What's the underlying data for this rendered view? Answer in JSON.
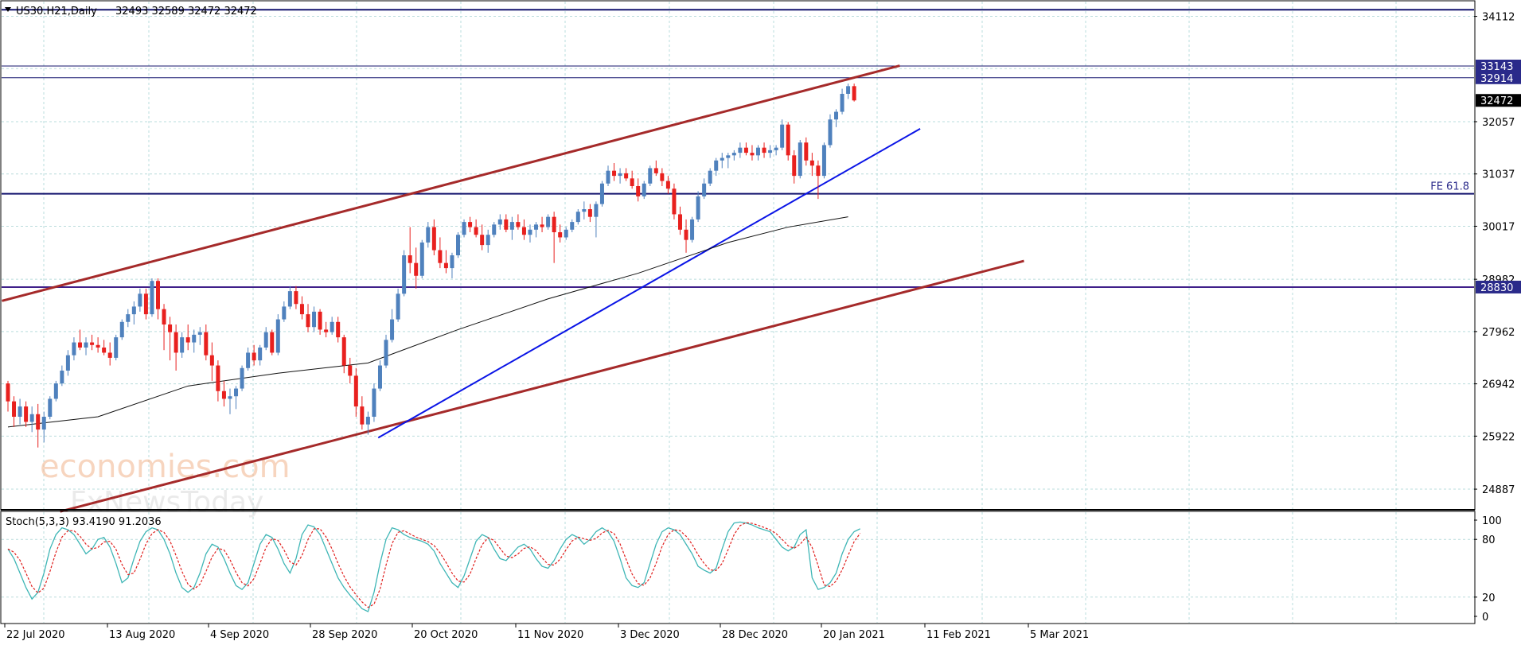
{
  "header": {
    "symbol_label": "US30.H21,Daily",
    "ohlc_text": "32493 32589 32472 32472"
  },
  "watermark": {
    "line1": "economies.com",
    "line2": "FxNewsToday"
  },
  "colors": {
    "background": "#ffffff",
    "grid": "#b9dcdc",
    "bull": "#4f81bd",
    "bear": "#e8201e",
    "channel": "#a52a2a",
    "trendline": "#0a14e6",
    "horizontal_line": "#14146e",
    "stoch_main": "#3fb6b6",
    "stoch_signal": "#e0201e",
    "ma": "#111111"
  },
  "chart_data": [
    {
      "type": "candlestick",
      "title": "US30.H21,Daily",
      "y_ticks": [
        34112,
        33143,
        32914,
        32472,
        32057,
        31037,
        30017,
        28982,
        28830,
        27962,
        26942,
        25922,
        24887
      ],
      "ylim": [
        24500,
        34400
      ],
      "x_tick_labels": [
        "22 Jul 2020",
        "13 Aug 2020",
        "4 Sep 2020",
        "28 Sep 2020",
        "20 Oct 2020",
        "11 Nov 2020",
        "3 Dec 2020",
        "28 Dec 2020",
        "20 Jan 2021",
        "11 Feb 2021",
        "5 Mar 2021"
      ],
      "grid": true,
      "last_price": 32472,
      "ohlc": [
        [
          26950,
          27000,
          26400,
          26600
        ],
        [
          26600,
          26700,
          26100,
          26300
        ],
        [
          26300,
          26650,
          26150,
          26500
        ],
        [
          26500,
          26600,
          26100,
          26200
        ],
        [
          26200,
          26500,
          26000,
          26350
        ],
        [
          26350,
          26550,
          25700,
          26050
        ],
        [
          26050,
          26400,
          25800,
          26300
        ],
        [
          26300,
          26700,
          26250,
          26650
        ],
        [
          26650,
          27000,
          26600,
          26950
        ],
        [
          26950,
          27300,
          26900,
          27200
        ],
        [
          27200,
          27600,
          27100,
          27500
        ],
        [
          27500,
          27850,
          27400,
          27750
        ],
        [
          27750,
          28000,
          27600,
          27650
        ],
        [
          27650,
          27850,
          27500,
          27750
        ],
        [
          27750,
          27900,
          27600,
          27700
        ],
        [
          27700,
          27850,
          27550,
          27650
        ],
        [
          27650,
          27800,
          27500,
          27550
        ],
        [
          27550,
          27750,
          27300,
          27450
        ],
        [
          27450,
          27900,
          27400,
          27850
        ],
        [
          27850,
          28200,
          27800,
          28150
        ],
        [
          28150,
          28400,
          28050,
          28300
        ],
        [
          28300,
          28550,
          28100,
          28450
        ],
        [
          28450,
          28800,
          28350,
          28700
        ],
        [
          28700,
          28800,
          28200,
          28300
        ],
        [
          28300,
          29000,
          28250,
          28950
        ],
        [
          28950,
          29000,
          28200,
          28400
        ],
        [
          28400,
          28500,
          27600,
          28100
        ],
        [
          28100,
          28250,
          27400,
          27950
        ],
        [
          27950,
          28100,
          27200,
          27550
        ],
        [
          27550,
          27950,
          27450,
          27850
        ],
        [
          27850,
          28100,
          27600,
          27750
        ],
        [
          27750,
          28000,
          27550,
          27900
        ],
        [
          27900,
          28050,
          27700,
          27950
        ],
        [
          27950,
          28100,
          27400,
          27500
        ],
        [
          27500,
          27750,
          27000,
          27300
        ],
        [
          27300,
          27400,
          26600,
          26800
        ],
        [
          26800,
          27000,
          26500,
          26650
        ],
        [
          26650,
          26850,
          26350,
          26700
        ],
        [
          26700,
          26900,
          26450,
          26850
        ],
        [
          26850,
          27300,
          26800,
          27250
        ],
        [
          27250,
          27650,
          27200,
          27550
        ],
        [
          27550,
          27700,
          27300,
          27400
        ],
        [
          27400,
          27700,
          27300,
          27650
        ],
        [
          27650,
          28050,
          27600,
          27950
        ],
        [
          27950,
          28000,
          27500,
          27550
        ],
        [
          27550,
          28300,
          27500,
          28200
        ],
        [
          28200,
          28550,
          28150,
          28450
        ],
        [
          28450,
          28850,
          28400,
          28750
        ],
        [
          28750,
          28850,
          28400,
          28500
        ],
        [
          28500,
          28650,
          28200,
          28300
        ],
        [
          28300,
          28500,
          27950,
          28050
        ],
        [
          28050,
          28450,
          27950,
          28350
        ],
        [
          28350,
          28400,
          27900,
          28000
        ],
        [
          28000,
          28150,
          27850,
          27950
        ],
        [
          27950,
          28250,
          27900,
          28150
        ],
        [
          28150,
          28250,
          27750,
          27850
        ],
        [
          27850,
          27900,
          27150,
          27300
        ],
        [
          27300,
          27450,
          26950,
          27100
        ],
        [
          27100,
          27250,
          26300,
          26500
        ],
        [
          26500,
          26700,
          26050,
          26150
        ],
        [
          26150,
          26400,
          25950,
          26300
        ],
        [
          26300,
          26950,
          26200,
          26850
        ],
        [
          26850,
          27400,
          26800,
          27300
        ],
        [
          27300,
          27900,
          27250,
          27800
        ],
        [
          27800,
          28400,
          27750,
          28200
        ],
        [
          28200,
          28800,
          28150,
          28700
        ],
        [
          28700,
          29550,
          28650,
          29450
        ],
        [
          29450,
          30000,
          29100,
          29300
        ],
        [
          29300,
          29600,
          28800,
          29050
        ],
        [
          29050,
          29750,
          29000,
          29700
        ],
        [
          29700,
          30100,
          29600,
          30000
        ],
        [
          30000,
          30150,
          29450,
          29550
        ],
        [
          29550,
          29800,
          29200,
          29300
        ],
        [
          29300,
          29550,
          29100,
          29200
        ],
        [
          29200,
          29500,
          29000,
          29450
        ],
        [
          29450,
          29900,
          29400,
          29850
        ],
        [
          29850,
          30150,
          29800,
          30100
        ],
        [
          30100,
          30200,
          29900,
          30000
        ],
        [
          30000,
          30150,
          29800,
          29850
        ],
        [
          29850,
          30050,
          29550,
          29650
        ],
        [
          29650,
          29950,
          29500,
          29850
        ],
        [
          29850,
          30100,
          29800,
          30050
        ],
        [
          30050,
          30250,
          29950,
          30150
        ],
        [
          30150,
          30250,
          29900,
          29950
        ],
        [
          29950,
          30200,
          29750,
          30100
        ],
        [
          30100,
          30250,
          29950,
          30000
        ],
        [
          30000,
          30150,
          29750,
          29850
        ],
        [
          29850,
          30050,
          29700,
          29950
        ],
        [
          29950,
          30100,
          29800,
          30050
        ],
        [
          30050,
          30200,
          29900,
          30000
        ],
        [
          30000,
          30250,
          29950,
          30200
        ],
        [
          30200,
          30300,
          29300,
          29900
        ],
        [
          29900,
          30050,
          29700,
          29800
        ],
        [
          29800,
          30000,
          29750,
          29950
        ],
        [
          29950,
          30150,
          29900,
          30100
        ],
        [
          30100,
          30350,
          30050,
          30300
        ],
        [
          30300,
          30500,
          30150,
          30350
        ],
        [
          30350,
          30450,
          30100,
          30200
        ],
        [
          30200,
          30500,
          29800,
          30450
        ],
        [
          30450,
          30900,
          30400,
          30850
        ],
        [
          30850,
          31200,
          30800,
          31100
        ],
        [
          31100,
          31250,
          30900,
          31000
        ],
        [
          31000,
          31150,
          30850,
          31050
        ],
        [
          31050,
          31150,
          30900,
          30950
        ],
        [
          30950,
          31100,
          30750,
          30800
        ],
        [
          30800,
          30950,
          30500,
          30600
        ],
        [
          30600,
          30900,
          30550,
          30850
        ],
        [
          30850,
          31200,
          30800,
          31150
        ],
        [
          31150,
          31300,
          31000,
          31050
        ],
        [
          31050,
          31150,
          30800,
          30900
        ],
        [
          30900,
          31000,
          30650,
          30750
        ],
        [
          30750,
          30850,
          30150,
          30250
        ],
        [
          30250,
          30400,
          29850,
          29950
        ],
        [
          29950,
          30150,
          29500,
          29750
        ],
        [
          29750,
          30200,
          29700,
          30150
        ],
        [
          30150,
          30700,
          30100,
          30600
        ],
        [
          30600,
          30950,
          30550,
          30850
        ],
        [
          30850,
          31150,
          30800,
          31100
        ],
        [
          31100,
          31350,
          31000,
          31300
        ],
        [
          31300,
          31450,
          31150,
          31350
        ],
        [
          31350,
          31450,
          31150,
          31400
        ],
        [
          31400,
          31500,
          31300,
          31450
        ],
        [
          31450,
          31650,
          31350,
          31550
        ],
        [
          31550,
          31650,
          31400,
          31450
        ],
        [
          31450,
          31600,
          31300,
          31400
        ],
        [
          31400,
          31600,
          31300,
          31550
        ],
        [
          31550,
          31650,
          31350,
          31450
        ],
        [
          31450,
          31600,
          31350,
          31500
        ],
        [
          31500,
          31600,
          31400,
          31550
        ],
        [
          31550,
          32100,
          31500,
          32000
        ],
        [
          32000,
          32050,
          31300,
          31400
        ],
        [
          31400,
          31500,
          30850,
          31000
        ],
        [
          31000,
          31700,
          30950,
          31650
        ],
        [
          31650,
          31750,
          31200,
          31300
        ],
        [
          31300,
          31450,
          31000,
          31200
        ],
        [
          31200,
          31300,
          30550,
          31000
        ],
        [
          31000,
          31650,
          30950,
          31600
        ],
        [
          31600,
          32200,
          31550,
          32100
        ],
        [
          32100,
          32300,
          31950,
          32250
        ],
        [
          32250,
          32700,
          32200,
          32600
        ],
        [
          32600,
          32800,
          32500,
          32750
        ],
        [
          32750,
          32800,
          32450,
          32472
        ]
      ],
      "ma_points": [
        [
          0,
          26100
        ],
        [
          15,
          26300
        ],
        [
          30,
          26900
        ],
        [
          45,
          27150
        ],
        [
          60,
          27350
        ],
        [
          75,
          28000
        ],
        [
          90,
          28600
        ],
        [
          105,
          29100
        ],
        [
          120,
          29700
        ],
        [
          130,
          30000
        ],
        [
          140,
          30200
        ]
      ]
    },
    {
      "type": "line",
      "title": "Stoch(5,3,3) 93.4190 91.2036",
      "y_ticks": [
        100,
        80,
        20,
        0
      ],
      "ylim": [
        0,
        100
      ],
      "main_values": [
        70,
        60,
        45,
        30,
        18,
        25,
        45,
        70,
        85,
        92,
        90,
        85,
        75,
        65,
        70,
        80,
        82,
        72,
        55,
        35,
        40,
        60,
        78,
        88,
        92,
        90,
        80,
        65,
        45,
        30,
        25,
        30,
        45,
        65,
        75,
        72,
        60,
        45,
        32,
        28,
        35,
        55,
        75,
        85,
        82,
        70,
        55,
        45,
        60,
        85,
        95,
        93,
        85,
        70,
        55,
        40,
        30,
        22,
        15,
        8,
        5,
        25,
        55,
        80,
        92,
        90,
        85,
        82,
        80,
        78,
        75,
        68,
        55,
        45,
        35,
        30,
        42,
        60,
        78,
        85,
        82,
        70,
        60,
        58,
        65,
        72,
        75,
        70,
        60,
        52,
        50,
        58,
        70,
        80,
        85,
        82,
        75,
        80,
        88,
        92,
        88,
        78,
        60,
        40,
        32,
        30,
        35,
        55,
        75,
        88,
        92,
        90,
        85,
        75,
        65,
        52,
        48,
        45,
        50,
        70,
        88,
        97,
        98,
        97,
        95,
        92,
        90,
        88,
        80,
        72,
        68,
        72,
        85,
        90,
        40,
        28,
        30,
        35,
        45,
        65,
        80,
        88,
        91
      ]
    }
  ],
  "price_labels": {
    "fe_label": "FE 61.8",
    "level_1": "33143",
    "level_2": "32914",
    "current": "32472",
    "support": "28830"
  }
}
